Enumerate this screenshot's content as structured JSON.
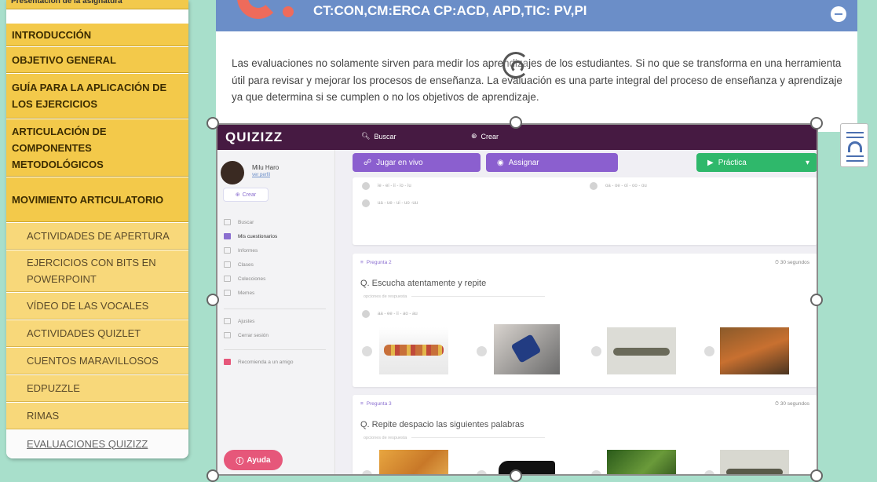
{
  "sidebar": {
    "top_partial": "Presentación de la asignatura",
    "main_items": [
      {
        "label": "INTRODUCCIÓN"
      },
      {
        "label": "OBJETIVO GENERAL"
      },
      {
        "label": "GUÍA PARA LA APLICACIÓN DE LOS EJERCICIOS"
      },
      {
        "label": "ARTICULACIÓN DE COMPONENTES METODOLÓGICOS"
      },
      {
        "label": "MOVIMIENTO ARTICULATORIO"
      }
    ],
    "sub_items": [
      {
        "label": "ACTIVIDADES DE APERTURA"
      },
      {
        "label": "EJERCICIOS CON BITS EN POWERPOINT"
      },
      {
        "label": "VÍDEO DE LAS VOCALES"
      },
      {
        "label": "ACTIVIDADES QUIZLET"
      },
      {
        "label": "CUENTOS MARAVILLOSOS"
      },
      {
        "label": "EDPUZZLE"
      },
      {
        "label": "RIMAS"
      },
      {
        "label": "EVALUACIONES QUIZIZZ",
        "active": true
      }
    ]
  },
  "card": {
    "title": "CT:CON,CM:ERCA CP:ACD, APD,TIC: PV,PI",
    "body": "Las evaluaciones no solamente sirven para medir los aprendizajes de los estudiantes. Si no que se transforma en una herramienta útil para revisar y mejorar los procesos de enseñanza. La evaluación es una parte integral del proceso de enseñanza y aprendizaje ya que determina si se cumplen o no los objetivos de aprendizaje."
  },
  "quizizz": {
    "logo": "QUIZIZZ",
    "search_label": "Buscar",
    "create_label": "Crear",
    "user_name": "Milu Haro",
    "user_link": "ver perfil",
    "sidebar_create": "Crear",
    "nav": [
      {
        "label": "Buscar"
      },
      {
        "label": "Mis cuestionarios",
        "active": true
      },
      {
        "label": "Informes"
      },
      {
        "label": "Clases"
      },
      {
        "label": "Colecciones"
      },
      {
        "label": "Memes"
      },
      {
        "label": "Ajustes"
      },
      {
        "label": "Cerrar sesión"
      },
      {
        "label": "Recomienda a un amigo"
      }
    ],
    "help_label": "Ayuda",
    "btn_live": "Jugar en vivo",
    "btn_assign": "Assignar",
    "btn_practice": "Práctica",
    "q1_opts": [
      "ie - ei - ii - io - iu",
      "oa - oe - oi - oo - ou",
      "ua - ue - ui - uo -uu"
    ],
    "q2": {
      "label": "Pregunta 2",
      "time": "30 segundos",
      "text": "Q. Escucha atentamente y repite",
      "sub": "opciones de respuesta",
      "opt": "aa - ee - ii - ao - au"
    },
    "q3": {
      "label": "Pregunta 3",
      "time": "30 segundos",
      "text": "Q. Repite despacio las siguientes palabras",
      "sub": "opciones de respuesta"
    }
  }
}
